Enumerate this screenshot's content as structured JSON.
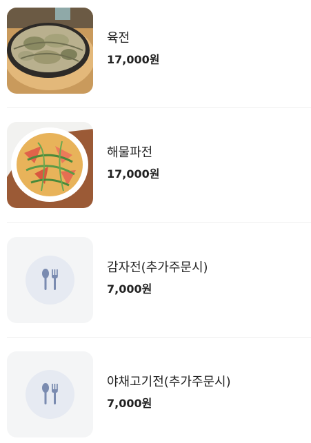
{
  "menu": {
    "items": [
      {
        "name": "육전",
        "price": "17,000원",
        "image": "pancake-photo"
      },
      {
        "name": "해물파전",
        "price": "17,000원",
        "image": "seafood-pancake-photo"
      },
      {
        "name": "감자전(추가주문시)",
        "price": "7,000원",
        "image": "utensils-placeholder-icon"
      },
      {
        "name": "야채고기전(추가주문시)",
        "price": "7,000원",
        "image": "utensils-placeholder-icon"
      }
    ]
  }
}
